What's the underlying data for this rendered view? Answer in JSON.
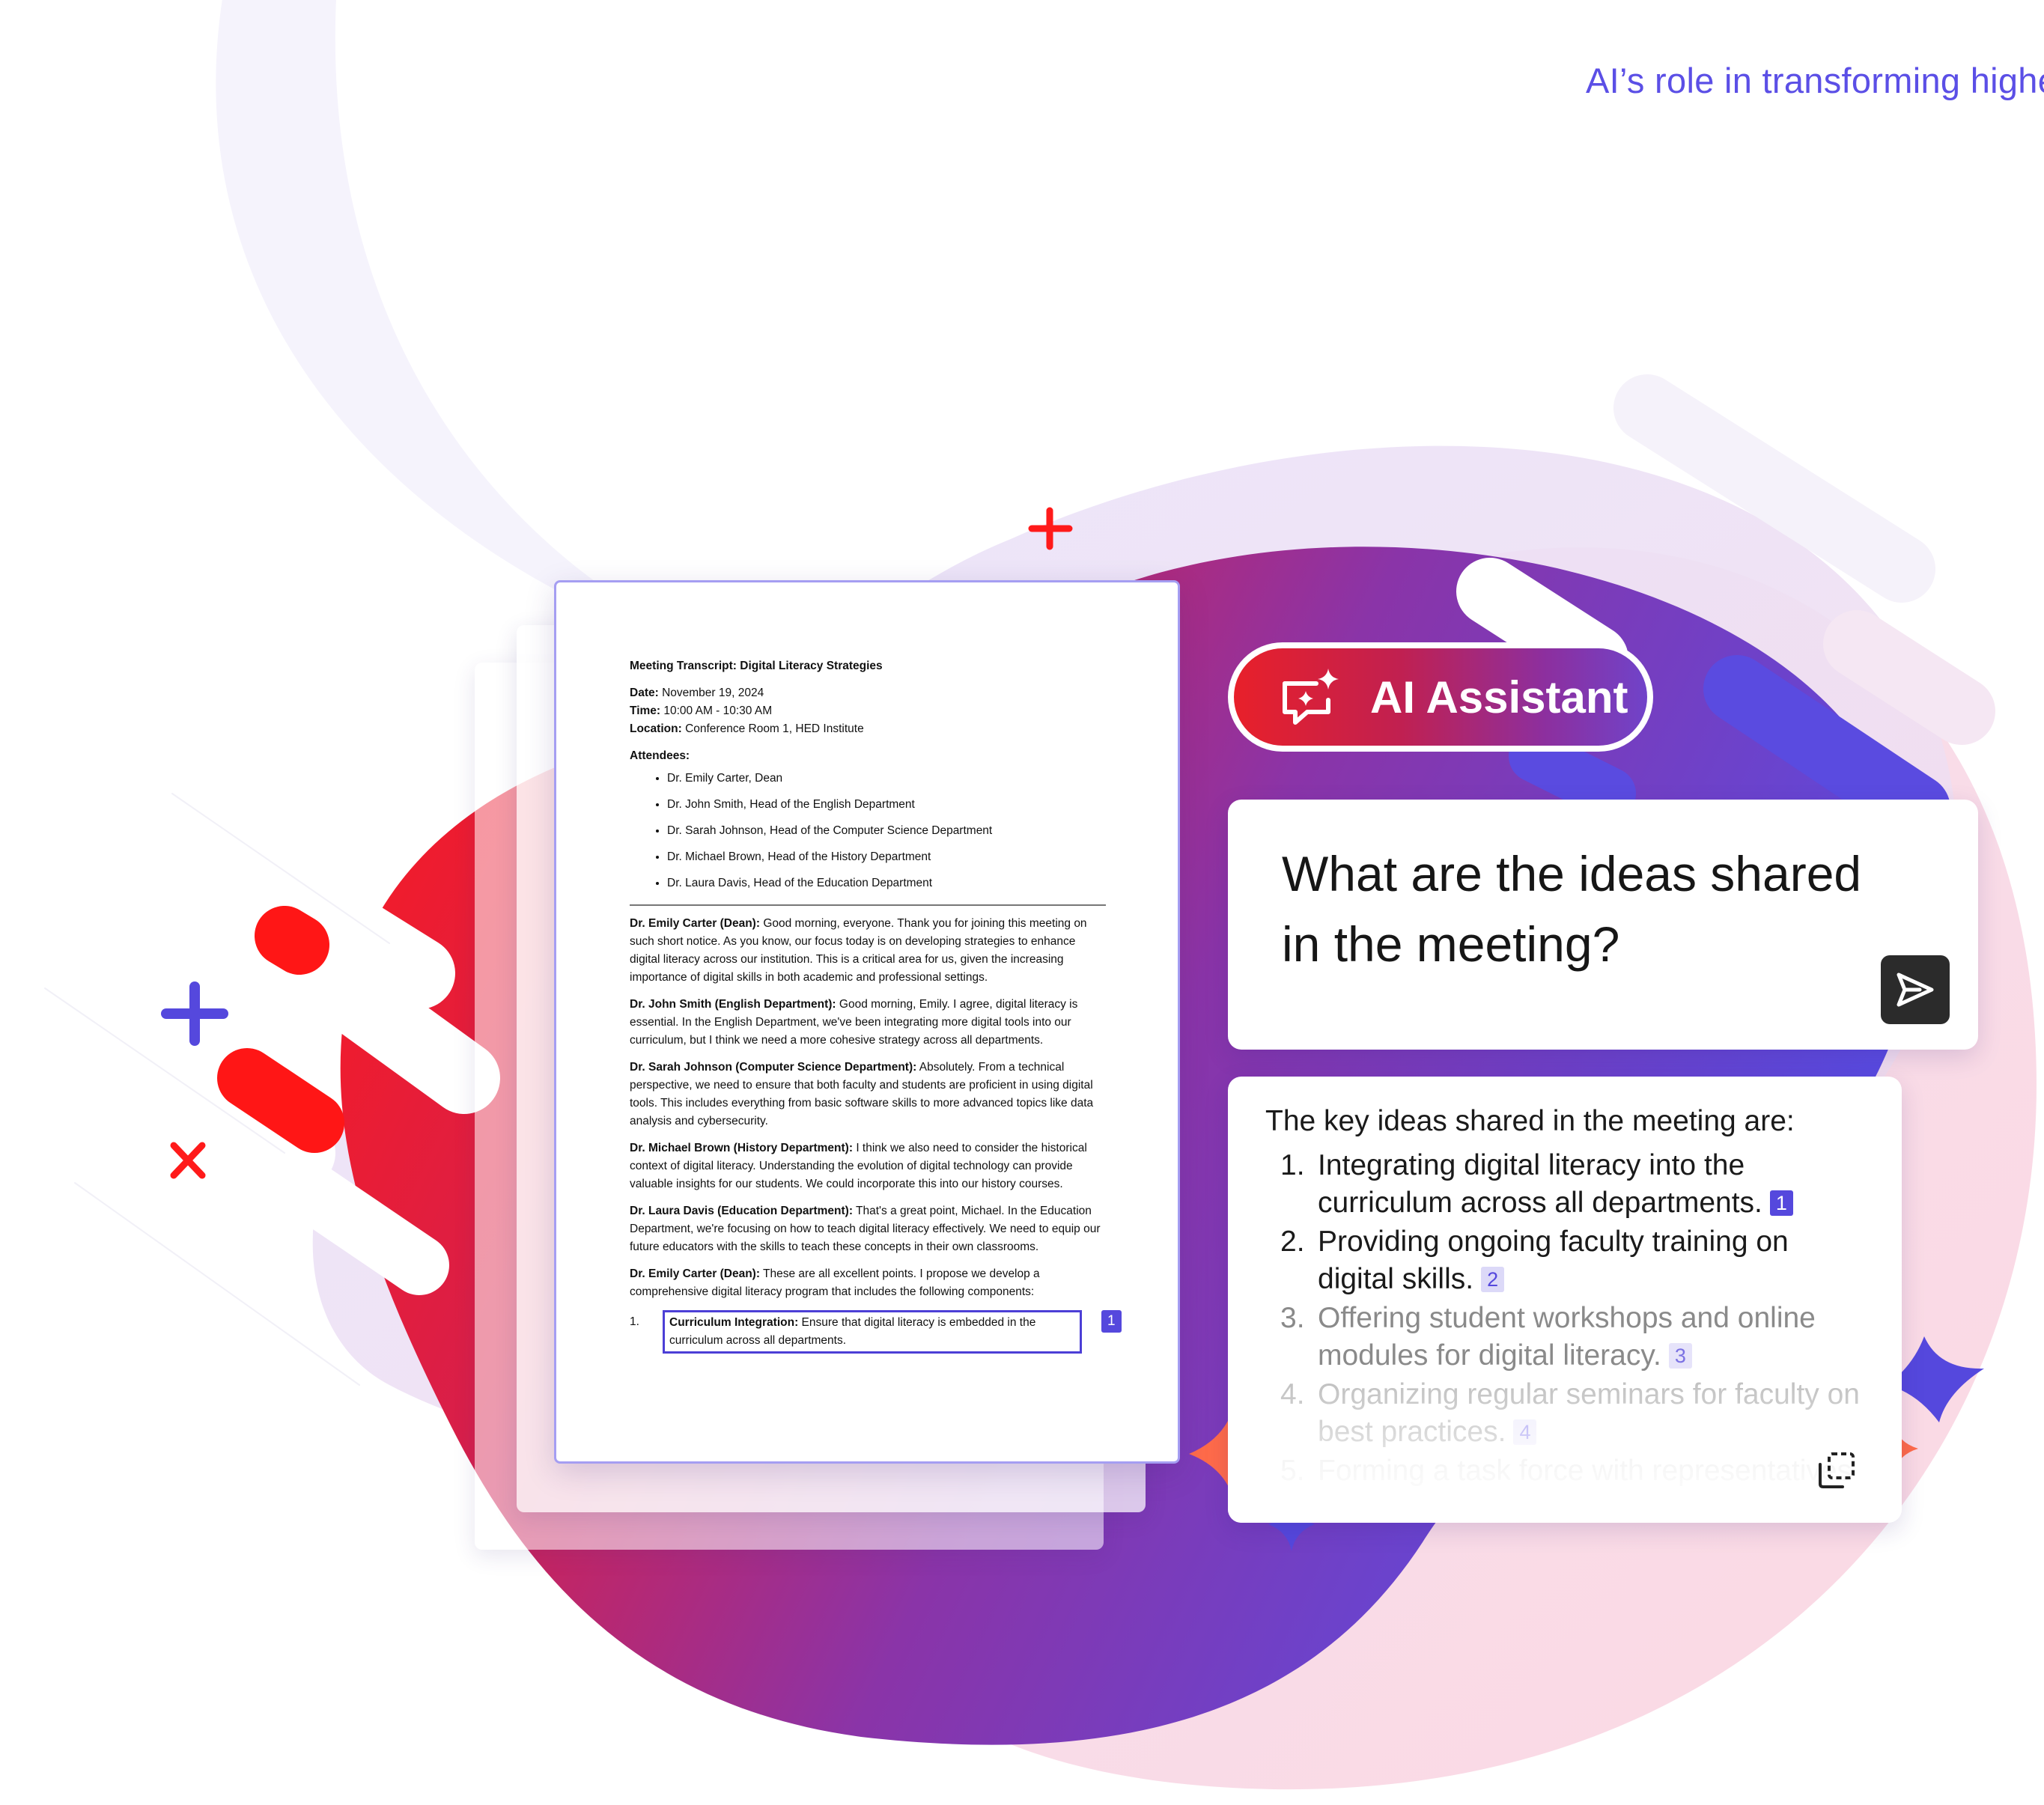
{
  "header": {
    "tagline": "AI’s role in transforming higher e"
  },
  "document": {
    "title": "Meeting Transcript: Digital Literacy Strategies",
    "meta": [
      {
        "label": "Date:",
        "value": "November 19, 2024"
      },
      {
        "label": "Time:",
        "value": "10:00 AM - 10:30 AM"
      },
      {
        "label": "Location:",
        "value": "Conference Room 1, HED Institute"
      }
    ],
    "attendees_label": "Attendees:",
    "attendees": [
      "Dr. Emily Carter, Dean",
      "Dr. John Smith, Head of the English Department",
      "Dr. Sarah Johnson, Head of the Computer Science Department",
      "Dr. Michael Brown, Head of the History Department",
      "Dr. Laura Davis, Head of the Education Department"
    ],
    "paragraphs": [
      {
        "speaker": "Dr. Emily Carter (Dean):",
        "text": "Good morning, everyone. Thank you for joining this meeting on such short notice. As you know, our focus today is on developing strategies to enhance digital literacy across our institution. This is a critical area for us, given the increasing importance of digital skills in both academic and professional settings."
      },
      {
        "speaker": "Dr. John Smith (English Department):",
        "text": "Good morning, Emily. I agree, digital literacy is essential. In the English Department, we've been integrating more digital tools into our curriculum, but I think we need a more cohesive strategy across all departments."
      },
      {
        "speaker": "Dr. Sarah Johnson (Computer Science Department):",
        "text": "Absolutely. From a technical perspective, we need to ensure that both faculty and students are proficient in using digital tools. This includes everything from basic software skills to more advanced topics like data analysis and cybersecurity."
      },
      {
        "speaker": "Dr. Michael Brown (History Department):",
        "text": "I think we also need to consider the historical context of digital literacy. Understanding the evolution of digital technology can provide valuable insights for our students. We could incorporate this into our history courses."
      },
      {
        "speaker": "Dr. Laura Davis (Education Department):",
        "text": "That's a great point, Michael. In the Education Department, we're focusing on how to teach digital literacy effectively. We need to equip our future educators with the skills to teach these concepts in their own classrooms."
      },
      {
        "speaker": "Dr. Emily Carter (Dean):",
        "text": "These are all excellent points. I propose we develop a comprehensive digital literacy program that includes the following components:"
      }
    ],
    "list_item": {
      "number": "1.",
      "label": "Curriculum Integration:",
      "text": "Ensure that digital literacy is embedded in the curriculum across all departments.",
      "citation": "1"
    }
  },
  "assistant": {
    "pill_label": "AI Assistant",
    "pill_icon": "ai-chat-sparkle-icon",
    "question": "What are the ideas shared in the meeting?",
    "send_icon": "send-icon",
    "answer_intro": "The key ideas shared in the meeting are:",
    "answers": [
      {
        "num": "1.",
        "text": "Integrating digital literacy into the curriculum across all departments.",
        "cite": "1"
      },
      {
        "num": "2.",
        "text": "Providing ongoing faculty training on digital skills.",
        "cite": "2"
      },
      {
        "num": "3.",
        "text": "Offering student workshops and online modules for digital literacy.",
        "cite": "3"
      },
      {
        "num": "4.",
        "text": "Organizing regular seminars for faculty on best practices.",
        "cite": "4"
      },
      {
        "num": "5.",
        "text": "Forming a task force with representatives",
        "cite": ""
      }
    ],
    "copy_icon": "copy-icon"
  },
  "colors": {
    "accent_purple": "#5548dd",
    "brand_red": "#e8202a",
    "tagline": "#5b4fe6"
  }
}
